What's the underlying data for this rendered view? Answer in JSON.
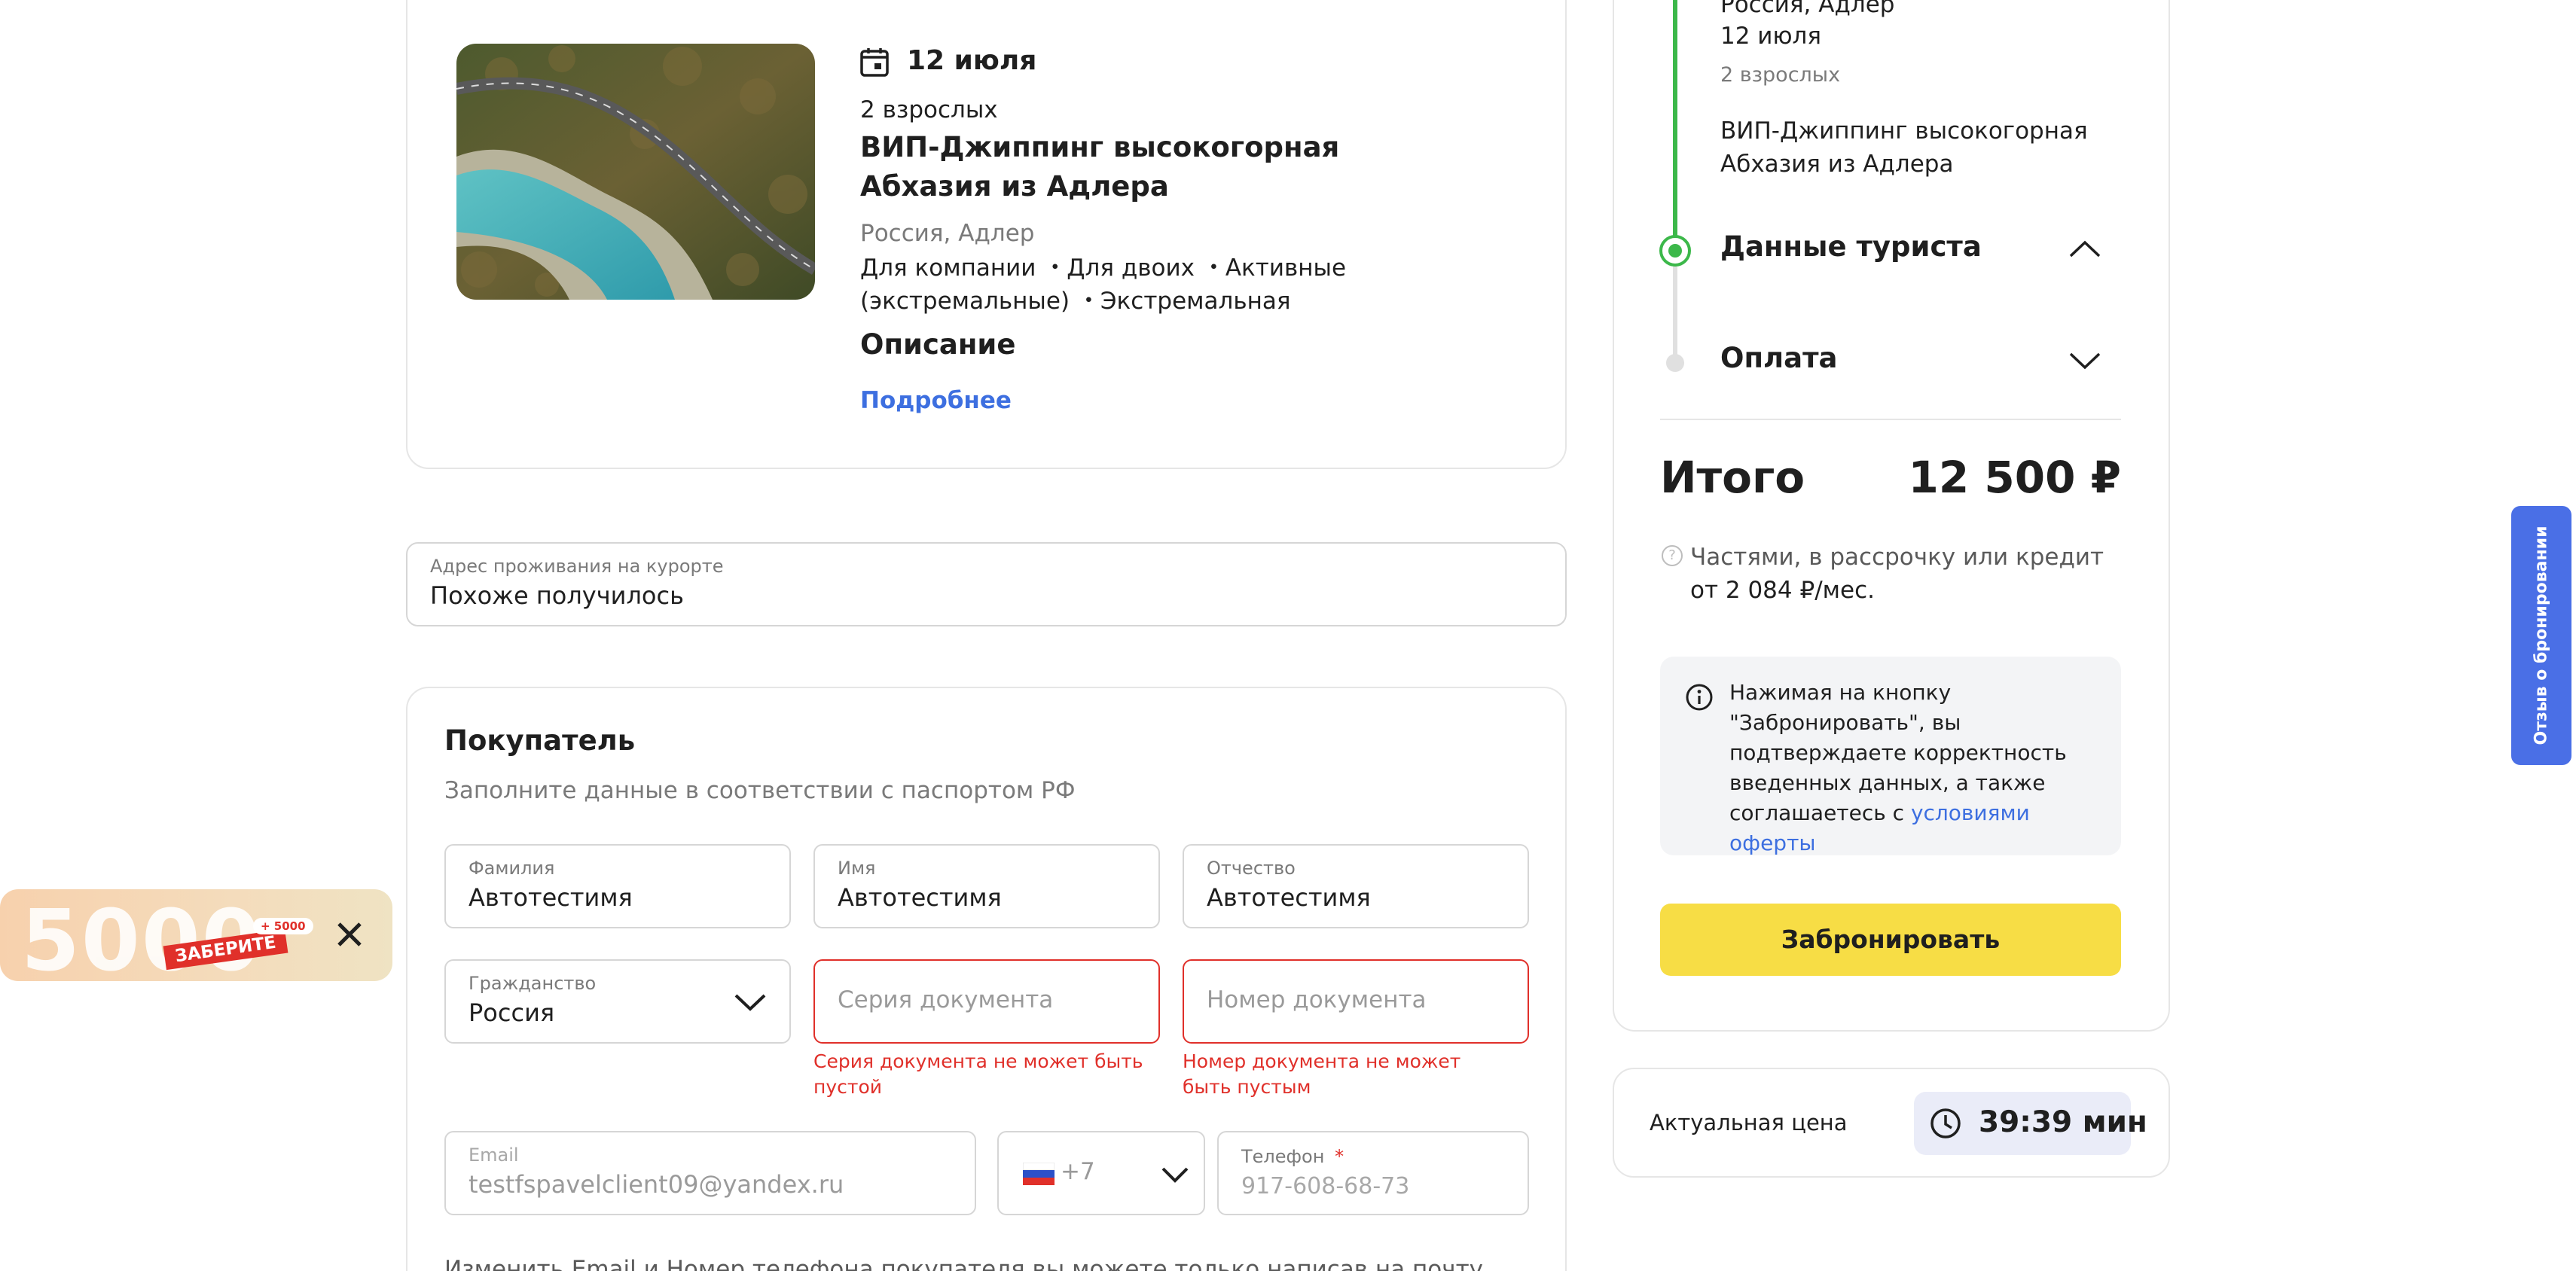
{
  "tour": {
    "date": "12 июля",
    "adults": "2 взрослых",
    "title": "ВИП-Джиппинг высокогорная Абхазия из Адлера",
    "place": "Россия, Адлер",
    "tags": "Для компании ・Для двоих ・Активные (экстремальные) ・Экстремальная",
    "description_heading": "Описание",
    "more_link": "Подробнее"
  },
  "address": {
    "label": "Адрес проживания на курорте",
    "value": "Похоже получилось"
  },
  "buyer": {
    "heading": "Покупатель",
    "subtitle": "Заполните данные в соответствии с паспортом РФ",
    "last_name": {
      "label": "Фамилия",
      "value": "Автотестимя"
    },
    "first_name": {
      "label": "Имя",
      "value": "Автотестимя"
    },
    "middle_name": {
      "label": "Отчество",
      "value": "Автотестимя"
    },
    "citizenship": {
      "label": "Гражданство",
      "value": "Россия"
    },
    "doc_series": {
      "placeholder": "Серия документа",
      "error": "Серия документа не может быть пустой"
    },
    "doc_number": {
      "placeholder": "Номер документа",
      "error": "Номер документа не может быть пустым"
    },
    "email": {
      "label": "Email",
      "value": "testfspavelclient09@yandex.ru"
    },
    "phone_code": "+7",
    "phone": {
      "label": "Телефон",
      "required_mark": "*",
      "placeholder": "917-608-68-73"
    },
    "note": "Изменить Email и Номер телефона покупателя вы можете только написав на почту"
  },
  "promo": {
    "amount": "5000",
    "badge": "ЗАБЕРИТЕ",
    "pill": "+ 5000"
  },
  "sidebar": {
    "place": "Россия, Адлер",
    "date": "12 июля",
    "adults": "2 взрослых",
    "title": "ВИП-Джиппинг высокогорная Абхазия из Адлера",
    "step_tourist": "Данные туриста",
    "step_payment": "Оплата",
    "total_label": "Итого",
    "total_value": "12 500 ₽",
    "credit_line1": "Частями, в рассрочку или кредит",
    "credit_line2": "от 2 084 ₽/мес.",
    "info_text": "Нажимая на кнопку \"Забронировать\", вы подтверждаете корректность введенных данных, а также соглашаетесь с ",
    "info_link": "условиями оферты",
    "book_button": "Забронировать",
    "price_label": "Актуальная цена",
    "timer": "39:39 мин"
  },
  "feedback_tab": "Отзыв о бронировании",
  "colors": {
    "accent_blue": "#3d6fe0",
    "error_red": "#e0302a",
    "success_green": "#3cb84a",
    "book_yellow": "#f7dd45",
    "feedback_blue": "#4a6fe6"
  },
  "icons": [
    "calendar-icon",
    "chevron-up-icon",
    "chevron-down-icon",
    "question-icon",
    "info-icon",
    "clock-icon",
    "close-icon",
    "russia-flag-icon"
  ]
}
